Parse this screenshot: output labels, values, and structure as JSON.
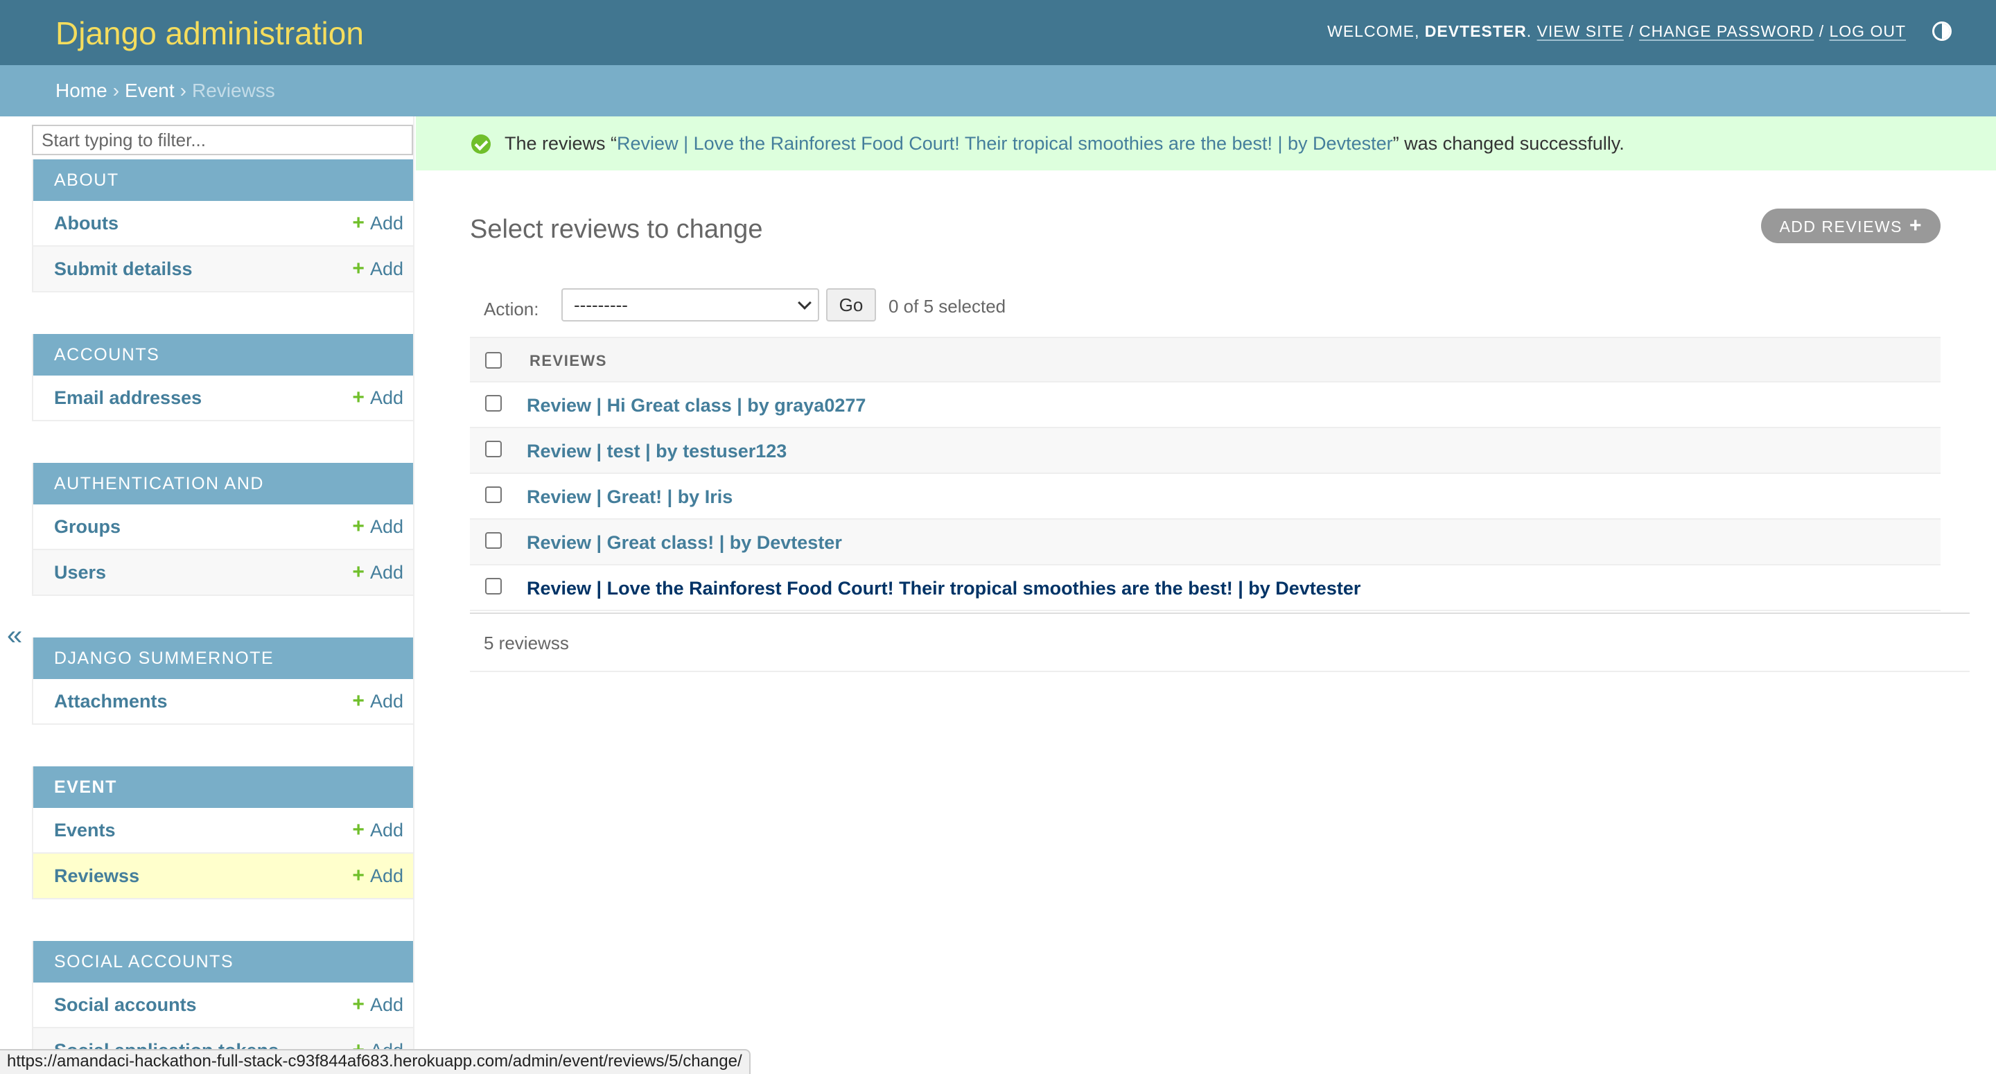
{
  "header": {
    "site_name": "Django administration",
    "welcome_prefix": "WELCOME,",
    "username": "DEVTESTER",
    "view_site": "VIEW SITE",
    "change_password": "CHANGE PASSWORD",
    "log_out": "LOG OUT",
    "theme_icon": "theme-toggle-icon"
  },
  "breadcrumbs": {
    "home": "Home",
    "sep": "›",
    "app": "Event",
    "current": "Reviewss"
  },
  "sidebar": {
    "filter_placeholder": "Start typing to filter...",
    "collapse_glyph": "«",
    "add_plus": "+",
    "add_label": "Add",
    "modules": [
      {
        "caption": "About",
        "models": [
          "Abouts",
          "Submit detailss"
        ]
      },
      {
        "caption": "Accounts",
        "models": [
          "Email addresses"
        ]
      },
      {
        "caption": "Authentication and Authorization",
        "models": [
          "Groups",
          "Users"
        ]
      },
      {
        "caption": "Django Summernote",
        "models": [
          "Attachments"
        ]
      },
      {
        "caption": "Event",
        "models": [
          "Events",
          "Reviewss"
        ]
      },
      {
        "caption": "Social Accounts",
        "models": [
          "Social accounts",
          "Social application tokens"
        ]
      }
    ]
  },
  "message": {
    "prefix": "The reviews “",
    "object": "Review | Love the Rainforest Food Court! Their tropical smoothies are the best! | by Devtester",
    "suffix": "” was changed successfully."
  },
  "content": {
    "title": "Select reviews to change",
    "add_button": "ADD REVIEWS",
    "add_plus": "+",
    "action_label": "Action:",
    "action_value": "---------",
    "go": "Go",
    "selected_count": "0 of 5 selected",
    "column_header": "REVIEWS",
    "rows": [
      "Review | Hi Great class | by graya0277",
      "Review | test | by testuser123",
      "Review | Great! | by Iris",
      "Review | Great class! | by Devtester",
      "Review | Love the Rainforest Food Court! Their tropical smoothies are the best! | by Devtester"
    ],
    "paginator": "5 reviewss"
  },
  "status_bar": {
    "url": "https://amandaci-hackathon-full-stack-c93f844af683.herokuapp.com/admin/event/reviews/5/change/"
  },
  "colors": {
    "header_bg": "#417690",
    "site_name": "#f5dd5d",
    "breadcrumbs_bg": "#79aec8",
    "link": "#447e9b",
    "success_bg": "#ddffdd",
    "add_green": "#70bf2b",
    "selected_row": "#ffffcc"
  }
}
